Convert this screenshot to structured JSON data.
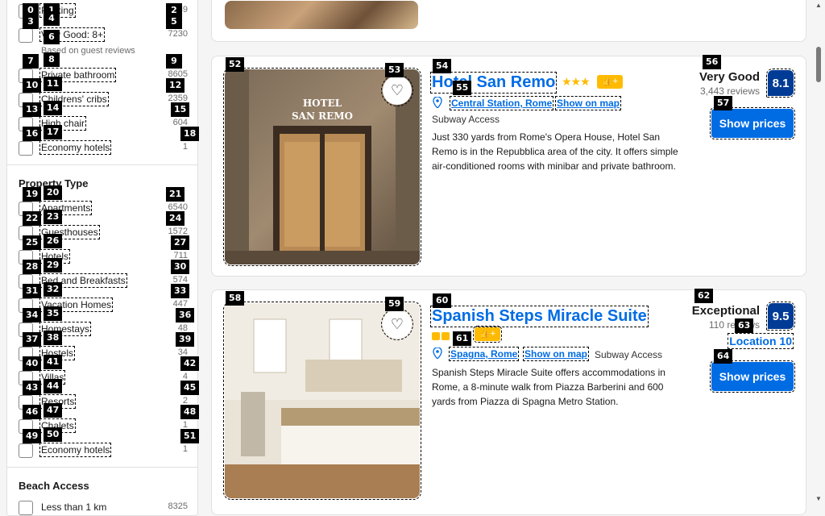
{
  "sidebar": {
    "top_filters": [
      {
        "label": "Parking",
        "count": "149"
      },
      {
        "label": "Very Good: 8+",
        "count": "7230"
      },
      {
        "label": "Private bathroom",
        "count": "8605"
      },
      {
        "label": "Childrens' cribs",
        "count": "2359"
      },
      {
        "label": "High chair",
        "count": "604"
      },
      {
        "label": "Economy hotels",
        "count": "1"
      }
    ],
    "based_on_reviews": "Based on guest reviews",
    "property_type": {
      "title": "Property Type",
      "items": [
        {
          "label": "Apartments",
          "count": "6540"
        },
        {
          "label": "Guesthouses",
          "count": "1572"
        },
        {
          "label": "Hotels",
          "count": "711"
        },
        {
          "label": "Bed and Breakfasts",
          "count": "574"
        },
        {
          "label": "Vacation Homes",
          "count": "447"
        },
        {
          "label": "Homestays",
          "count": "48"
        },
        {
          "label": "Hostels",
          "count": "34"
        },
        {
          "label": "Villas",
          "count": "4"
        },
        {
          "label": "Resorts",
          "count": "2"
        },
        {
          "label": "Chalets",
          "count": "1"
        },
        {
          "label": "Economy hotels",
          "count": "1"
        }
      ]
    },
    "beach_access": {
      "title": "Beach Access",
      "items": [
        {
          "label": "Less than 1 km",
          "count": "8325"
        }
      ]
    }
  },
  "hotels": [
    {
      "name": "Hotel San Remo",
      "stars": "★★★",
      "location": "Central Station, Rome",
      "show_on_map": "Show on map",
      "transit": "Subway Access",
      "description": "Just 330 yards from Rome's Opera House, Hotel San Remo is in the Repubblica area of the city. It offers simple air-conditioned rooms with minibar and private bathroom.",
      "rating_word": "Very Good",
      "reviews": "3,443 reviews",
      "score": "8.1",
      "button": "Show prices",
      "sign_text": "HOTEL\nSAN REMO"
    },
    {
      "name": "Spanish Steps Miracle Suite",
      "location": "Spagna, Rome",
      "show_on_map": "Show on map",
      "transit": "Subway Access",
      "description": "Spanish Steps Miracle Suite offers accommodations in Rome, a 8-minute walk from Piazza Barberini and 600 yards from Piazza di Spagna Metro Station.",
      "rating_word": "Exceptional",
      "reviews": "110 reviews",
      "score": "9.5",
      "location_score": "Location 10",
      "button": "Show prices"
    }
  ],
  "tags": [
    "0",
    "1",
    "2",
    "3",
    "4",
    "5",
    "6",
    "7",
    "8",
    "9",
    "10",
    "11",
    "12",
    "13",
    "14",
    "15",
    "16",
    "17",
    "18",
    "19",
    "20",
    "21",
    "22",
    "23",
    "24",
    "25",
    "26",
    "27",
    "28",
    "29",
    "30",
    "31",
    "32",
    "33",
    "34",
    "35",
    "36",
    "37",
    "38",
    "39",
    "40",
    "41",
    "42",
    "43",
    "44",
    "45",
    "46",
    "47",
    "48",
    "49",
    "50",
    "51",
    "52",
    "53",
    "54",
    "55",
    "56",
    "57",
    "58",
    "59",
    "60",
    "61",
    "62",
    "63",
    "64"
  ],
  "colors": {
    "accent": "#006ce4",
    "score_bg": "#003b95",
    "star": "#febb02"
  }
}
